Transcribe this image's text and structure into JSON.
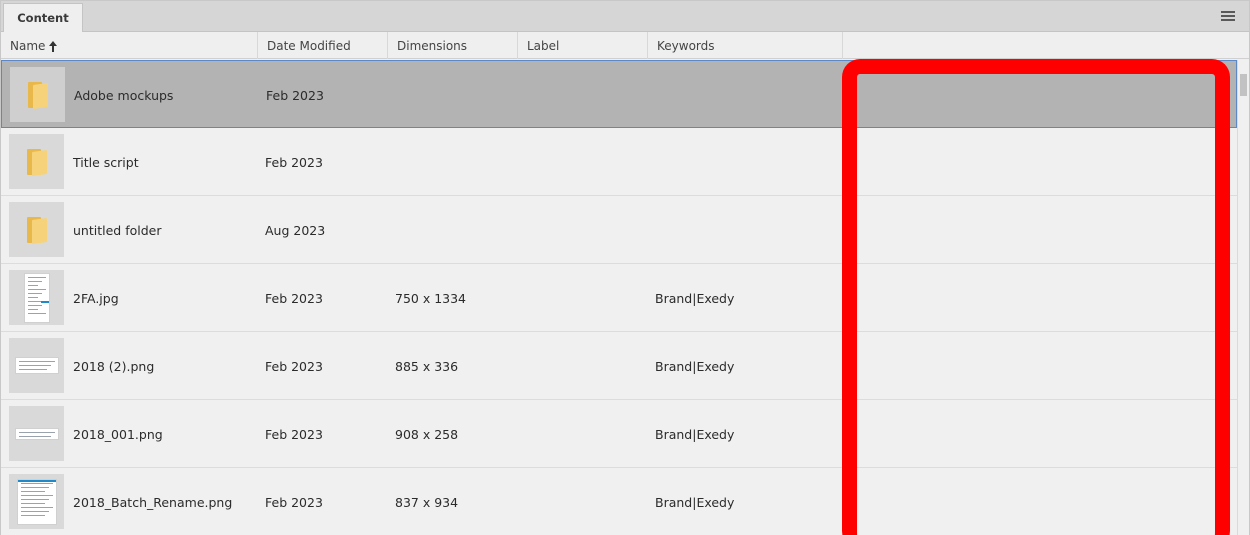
{
  "tab": {
    "label": "Content"
  },
  "columns": [
    {
      "label": "Name"
    },
    {
      "label": "Date Modified"
    },
    {
      "label": "Dimensions"
    },
    {
      "label": "Label"
    },
    {
      "label": "Keywords"
    }
  ],
  "rows": [
    {
      "name": "Adobe mockups",
      "date": "Feb 2023",
      "dimensions": "",
      "label": "",
      "keywords": "",
      "type": "folder",
      "selected": true
    },
    {
      "name": "Title script",
      "date": "Feb 2023",
      "dimensions": "",
      "label": "",
      "keywords": "",
      "type": "folder",
      "selected": false
    },
    {
      "name": "untitled folder",
      "date": "Aug 2023",
      "dimensions": "",
      "label": "",
      "keywords": "",
      "type": "folder",
      "selected": false
    },
    {
      "name": "2FA.jpg",
      "date": "Feb 2023",
      "dimensions": "750 x 1334",
      "label": "",
      "keywords": "Brand|Exedy",
      "type": "image-portrait",
      "selected": false
    },
    {
      "name": "2018 (2).png",
      "date": "Feb 2023",
      "dimensions": "885 x 336",
      "label": "",
      "keywords": "Brand|Exedy",
      "type": "image-wide",
      "selected": false
    },
    {
      "name": "2018_001.png",
      "date": "Feb 2023",
      "dimensions": "908 x 258",
      "label": "",
      "keywords": "Brand|Exedy",
      "type": "image-wide",
      "selected": false
    },
    {
      "name": "2018_Batch_Rename.png",
      "date": "Feb 2023",
      "dimensions": "837 x 934",
      "label": "",
      "keywords": "Brand|Exedy",
      "type": "image-square",
      "selected": false
    }
  ],
  "icons": {
    "menu": "hamburger-menu-icon",
    "sort": "sort-ascending-icon",
    "folder": "folder-icon"
  },
  "colors": {
    "annotation": "#ff0000",
    "selection": "#b3b3b3",
    "selection_border": "#5d87c6",
    "folder": "#f6d37a"
  }
}
